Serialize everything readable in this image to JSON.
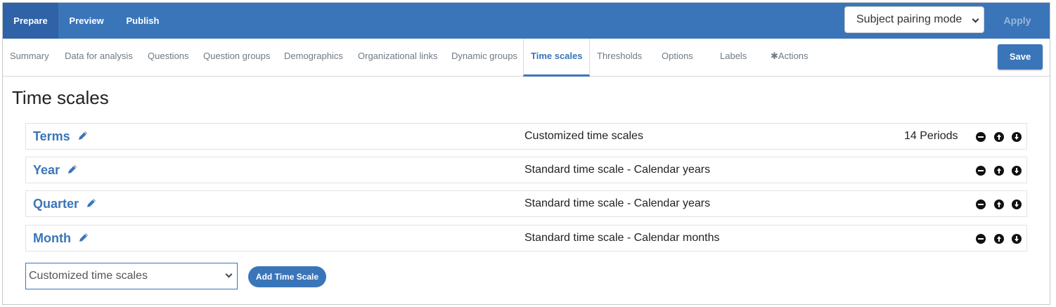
{
  "top_tabs": [
    {
      "label": "Prepare",
      "active": true
    },
    {
      "label": "Preview",
      "active": false
    },
    {
      "label": "Publish",
      "active": false
    }
  ],
  "mode_select": {
    "value": "Subject pairing mode"
  },
  "apply_label": "Apply",
  "sub_tabs": [
    {
      "label": "Summary"
    },
    {
      "label": "Data for analysis"
    },
    {
      "label": "Questions"
    },
    {
      "label": "Question groups"
    },
    {
      "label": "Demographics"
    },
    {
      "label": "Organizational links"
    },
    {
      "label": "Dynamic groups"
    },
    {
      "label": "Time scales",
      "active": true
    },
    {
      "label": "Thresholds"
    },
    {
      "label": "Options"
    },
    {
      "label": "Labels"
    },
    {
      "label": "✱Actions"
    }
  ],
  "save_label": "Save",
  "page_title": "Time scales",
  "time_scales": [
    {
      "name": "Terms",
      "description": "Customized time scales",
      "periods": "14 Periods"
    },
    {
      "name": "Year",
      "description": "Standard time scale - Calendar years",
      "periods": ""
    },
    {
      "name": "Quarter",
      "description": "Standard time scale - Calendar years",
      "periods": ""
    },
    {
      "name": "Month",
      "description": "Standard time scale - Calendar months",
      "periods": ""
    }
  ],
  "add_select": {
    "value": "Customized time scales"
  },
  "add_button_label": "Add Time Scale",
  "colors": {
    "brand": "#3a75b9",
    "active_tab": "#2f62a6"
  },
  "icons": [
    "edit-pencil-icon",
    "remove-icon",
    "move-up-icon",
    "move-down-icon",
    "chevron-down-icon"
  ]
}
